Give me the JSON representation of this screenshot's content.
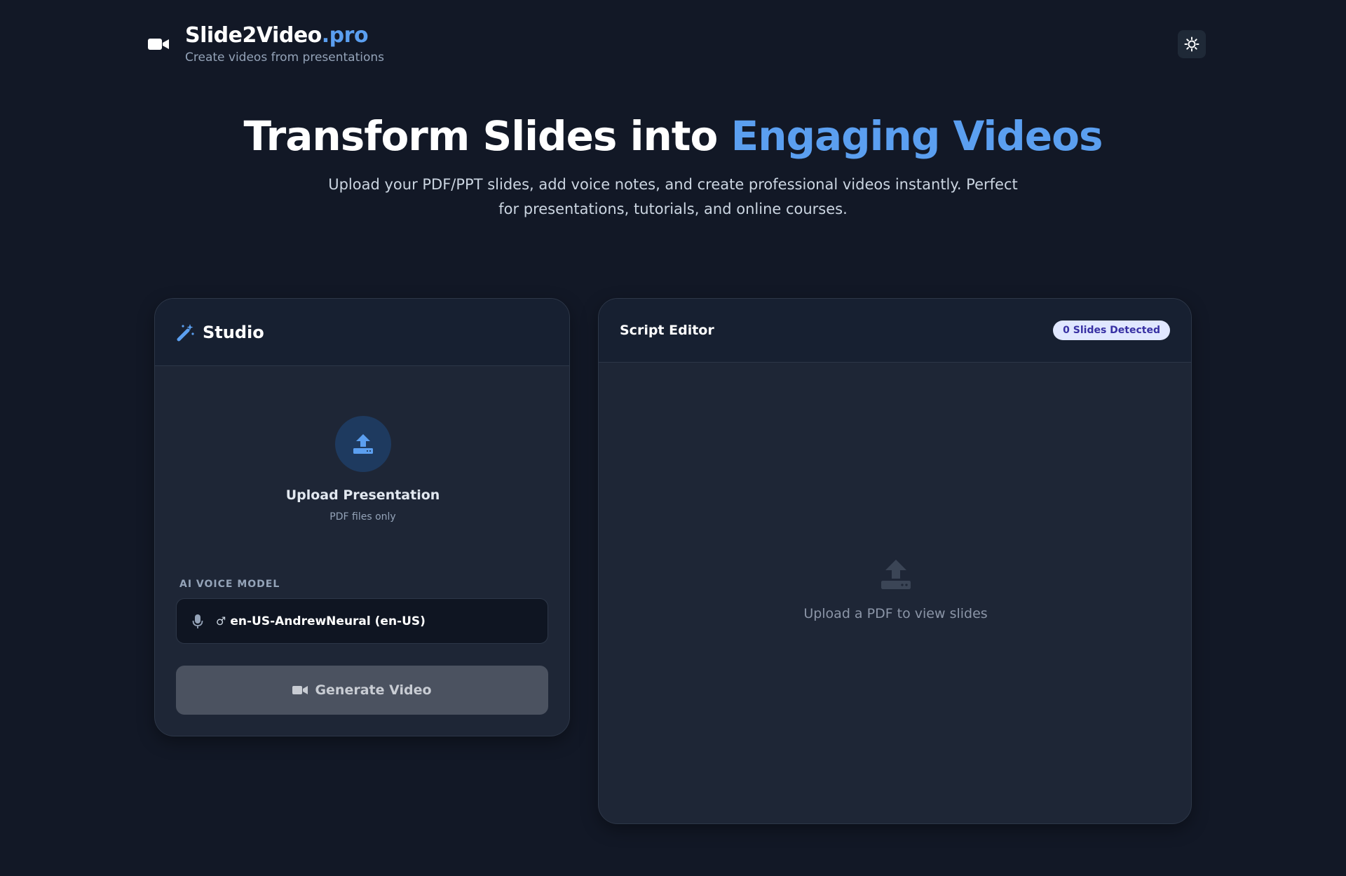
{
  "brand": {
    "name_main": "Slide2Video",
    "name_accent": ".pro",
    "tagline": "Create videos from presentations"
  },
  "hero": {
    "title_main": "Transform Slides into ",
    "title_accent": "Engaging Videos",
    "subtitle": "Upload your PDF/PPT slides, add voice notes, and create professional videos instantly. Perfect for presentations, tutorials, and online courses."
  },
  "studio": {
    "title": "Studio",
    "upload_title": "Upload Presentation",
    "upload_hint": "PDF files only",
    "voice_label": "AI VOICE MODEL",
    "voice_prefix": "♂",
    "voice_value": "en-US-AndrewNeural (en-US)",
    "generate_label": "Generate Video"
  },
  "editor": {
    "title": "Script Editor",
    "badge": "0 Slides Detected",
    "empty_text": "Upload a PDF to view slides"
  },
  "colors": {
    "background": "#121826",
    "accent": "#5b9ff0",
    "card": "#1e2636",
    "badge_bg": "#e0e7ff",
    "badge_text": "#3730a3"
  },
  "icons": {
    "logo": "video-camera-icon",
    "theme": "sun-icon",
    "studio": "magic-wand-icon",
    "upload": "upload-icon",
    "voice": "microphone-icon",
    "generate": "video-camera-icon"
  }
}
